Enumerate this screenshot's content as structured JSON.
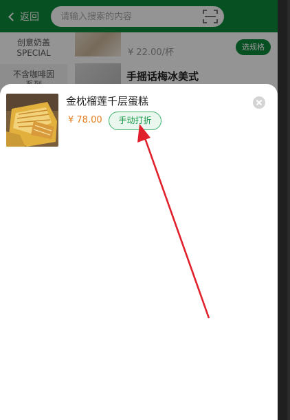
{
  "header": {
    "back_label": "返回",
    "search_placeholder": "请输入搜索的内容"
  },
  "categories": [
    {
      "line1": "创意奶盖",
      "line2": "SPECIAL"
    },
    {
      "line1": "不含咖啡因",
      "line2": "系列"
    }
  ],
  "products": [
    {
      "price": "¥ 22.00/杯",
      "button": "选规格"
    },
    {
      "name": "手摇话梅冰美式"
    }
  ],
  "sheet": {
    "title": "金枕榴莲千层蛋糕",
    "price": "¥ 78.00",
    "discount_button": "手动打折",
    "icons": {
      "close": "close-icon",
      "scan": "scan-icon",
      "back": "chevron-left-icon"
    }
  },
  "colors": {
    "brand_green": "#0b8a3a",
    "price_orange": "#e57a1c",
    "annotation_red": "#e0202a"
  }
}
